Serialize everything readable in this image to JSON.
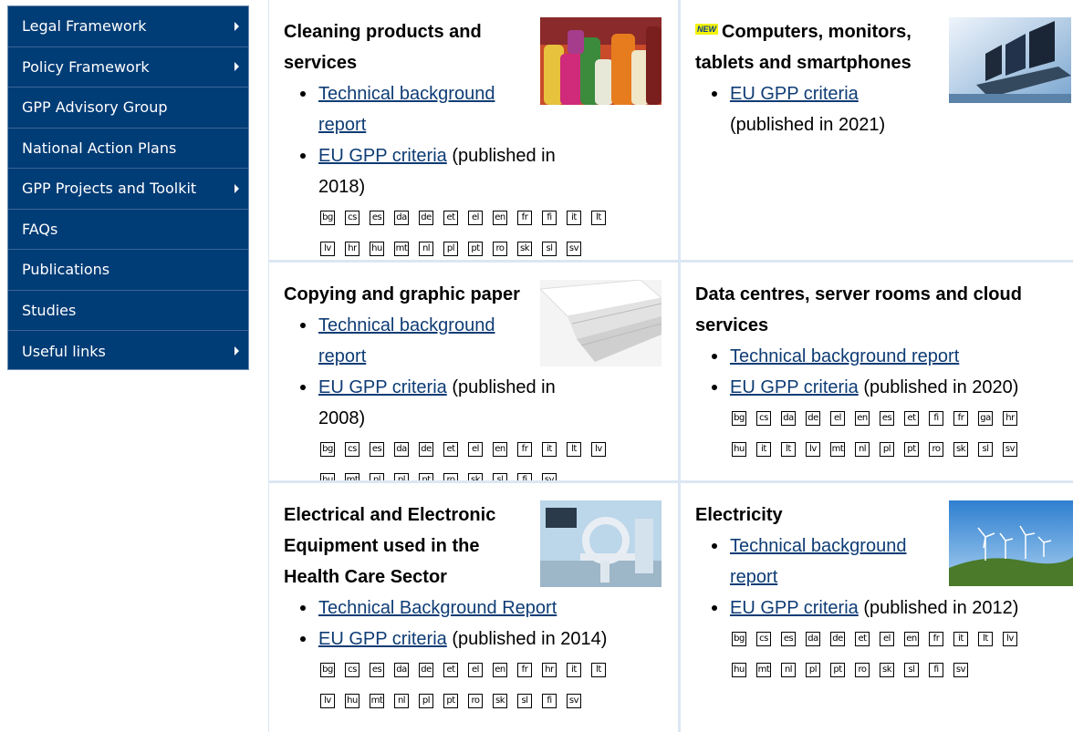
{
  "sidebar": {
    "items": [
      {
        "label": "Legal Framework",
        "has_arrow": true
      },
      {
        "label": "Policy Framework",
        "has_arrow": true
      },
      {
        "label": "GPP Advisory Group",
        "has_arrow": false
      },
      {
        "label": "National Action Plans",
        "has_arrow": false
      },
      {
        "label": "GPP Projects and Toolkit",
        "has_arrow": true
      },
      {
        "label": "FAQs",
        "has_arrow": false
      },
      {
        "label": "Publications",
        "has_arrow": false
      },
      {
        "label": "Studies",
        "has_arrow": false
      },
      {
        "label": "Useful links",
        "has_arrow": true
      }
    ]
  },
  "cards": [
    {
      "title": "Cleaning products and services",
      "badge": "",
      "links": [
        {
          "link": "Technical background report",
          "suffix": ""
        },
        {
          "link": "EU GPP criteria",
          "suffix": " (published in 2018)"
        }
      ],
      "lang_rows": [
        [
          "bg",
          "cs",
          "es",
          "da",
          "de",
          "et",
          "el",
          "en",
          "fr",
          "fi",
          "it",
          "lt"
        ],
        [
          "lv",
          "hr",
          "hu",
          "mt",
          "nl",
          "pl",
          "pt",
          "ro",
          "sk",
          "sl",
          "sv"
        ]
      ]
    },
    {
      "title": "Computers, monitors, tablets and smartphones",
      "badge": "NEW",
      "links": [
        {
          "link": "EU GPP criteria",
          "suffix": " (published in 2021)"
        }
      ],
      "lang_rows": []
    },
    {
      "title": "Copying and graphic paper",
      "badge": "",
      "links": [
        {
          "link": "Technical background report",
          "suffix": ""
        },
        {
          "link": "EU GPP criteria",
          "suffix": " (published in 2008)"
        }
      ],
      "lang_rows": [
        [
          "bg",
          "cs",
          "es",
          "da",
          "de",
          "et",
          "el",
          "en",
          "fr",
          "it",
          "lt",
          "lv"
        ],
        [
          "hu",
          "mt",
          "nl",
          "pl",
          "pt",
          "ro",
          "sk",
          "sl",
          "fi",
          "sv"
        ]
      ]
    },
    {
      "title": "Data centres, server rooms and cloud services",
      "badge": "",
      "links": [
        {
          "link": "Technical background report",
          "suffix": ""
        },
        {
          "link": "EU GPP criteria",
          "suffix": " (published in 2020)"
        }
      ],
      "lang_rows": [
        [
          "bg",
          "cs",
          "da",
          "de",
          "el",
          "en",
          "es",
          "et",
          "fi",
          "fr",
          "ga",
          "hr"
        ],
        [
          "hu",
          "it",
          "lt",
          "lv",
          "mt",
          "nl",
          "pl",
          "pt",
          "ro",
          "sk",
          "sl",
          "sv"
        ]
      ]
    },
    {
      "title": "Electrical and Electronic Equipment used in the Health Care Sector",
      "badge": "",
      "links": [
        {
          "link": "Technical Background Report",
          "suffix": ""
        },
        {
          "link": "EU GPP criteria",
          "suffix": " (published in 2014)"
        }
      ],
      "lang_rows": [
        [
          "bg",
          "cs",
          "es",
          "da",
          "de",
          "et",
          "el",
          "en",
          "fr",
          "hr",
          "it",
          "lt"
        ],
        [
          "lv",
          "hu",
          "mt",
          "nl",
          "pl",
          "pt",
          "ro",
          "sk",
          "sl",
          "fi",
          "sv"
        ]
      ]
    },
    {
      "title": "Electricity",
      "badge": "",
      "links": [
        {
          "link": "Technical background report",
          "suffix": ""
        },
        {
          "link": "EU GPP criteria",
          "suffix": " (published in 2012)"
        }
      ],
      "lang_rows": [
        [
          "bg",
          "cs",
          "es",
          "da",
          "de",
          "et",
          "el",
          "en",
          "fr",
          "it",
          "lt",
          "lv"
        ],
        [
          "hu",
          "mt",
          "nl",
          "pl",
          "pt",
          "ro",
          "sk",
          "sl",
          "fi",
          "sv"
        ]
      ]
    }
  ],
  "colors": {
    "sidebar_bg": "#003c76",
    "link": "#0e3c75",
    "cell_border": "#dbe7f3",
    "new_badge_bg": "#f2f20a"
  },
  "icons": [
    "cleaning-products-thumbnail",
    "computers-thumbnail",
    "paper-thumbnail",
    "health-equipment-thumbnail",
    "wind-turbines-thumbnail",
    "chevron-right-icon"
  ]
}
